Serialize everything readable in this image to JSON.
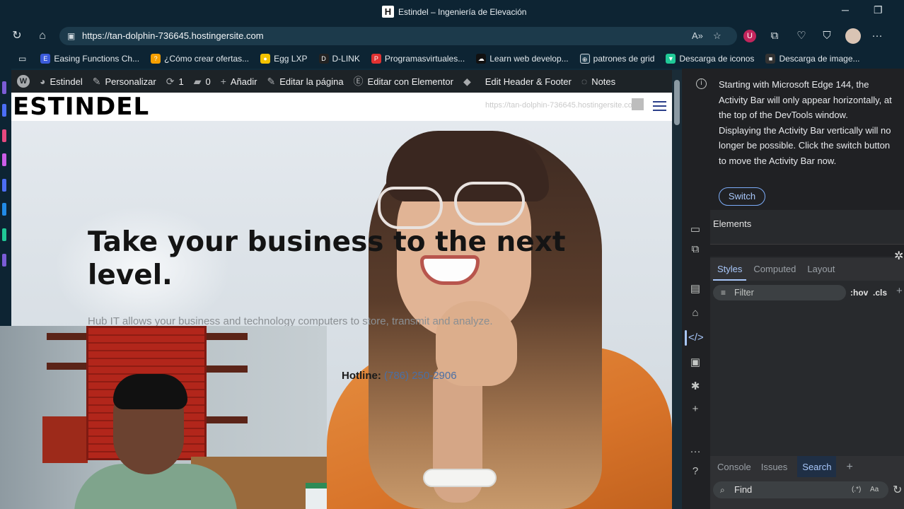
{
  "window": {
    "title": "Estindel – Ingeniería de Elevación",
    "logo_letter": "H"
  },
  "browser": {
    "url": "https://tan-dolphin-736645.hostingersite.com",
    "bookmarks": [
      {
        "label": "Easing Functions Ch...",
        "color": "#3b5bdb",
        "icon": "E"
      },
      {
        "label": "¿Cómo crear ofertas...",
        "color": "#f59f00",
        "icon": "?"
      },
      {
        "label": "Egg LXP",
        "color": "#f2c200",
        "icon": "●"
      },
      {
        "label": "D-LINK",
        "color": "#222222",
        "icon": "D"
      },
      {
        "label": "Programasvirtuales...",
        "color": "#e03131",
        "icon": "P"
      },
      {
        "label": "Learn web develop...",
        "color": "#111111",
        "icon": "☁"
      },
      {
        "label": "patrones de grid",
        "color": "#1c3a4b",
        "icon": "⊕"
      },
      {
        "label": "Descarga de iconos",
        "color": "#20c997",
        "icon": "▼"
      },
      {
        "label": "Descarga de image...",
        "color": "#333333",
        "icon": "■"
      }
    ]
  },
  "wp_admin_bar": {
    "site": "Estindel",
    "customize": "Personalizar",
    "updates_count": "1",
    "comments_count": "0",
    "add_new": "Añadir",
    "edit_page": "Editar la página",
    "edit_elementor": "Editar con Elementor",
    "edit_header_footer": "Edit Header & Footer",
    "notes": "Notes"
  },
  "site": {
    "brand": "ESTINDEL",
    "header_faint_text": "https://tan-dolphin-736645.hostingersite.com",
    "hero_heading": "Take your business to the next level.",
    "hero_subtext": "Hub IT allows your business and technology computers to store, transmit and analyze.",
    "hotline_label": "Hotline:",
    "hotline_number": "(786) 250-2906"
  },
  "devtools": {
    "notice": "Starting with Microsoft Edge 144, the Activity Bar will only appear horizontally, at the top of the DevTools window. Displaying the Activity Bar vertically will no longer be possible. Click the switch button to move the Activity Bar now.",
    "switch_label": "Switch",
    "elements_tab": "Elements",
    "subtabs": [
      "Styles",
      "Computed",
      "Layout"
    ],
    "filter_placeholder": "Filter",
    "hov_label": ":hov",
    "cls_label": ".cls",
    "drawer_tabs": [
      "Console",
      "Issues",
      "Search"
    ],
    "find_placeholder": "Find",
    "regex_label": "(.*)",
    "case_label": "Aa"
  }
}
